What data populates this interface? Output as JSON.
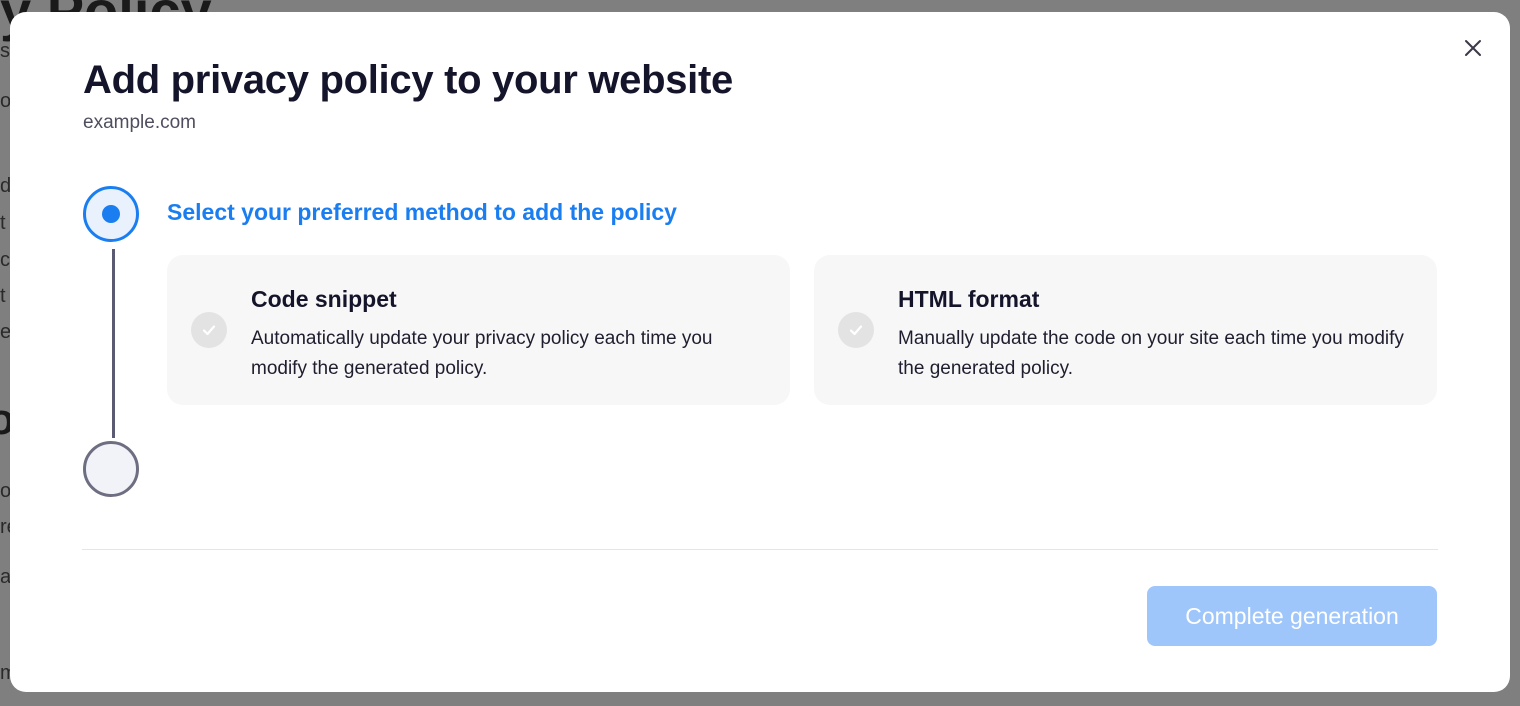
{
  "background": {
    "fragments": [
      "y Policy",
      "s,",
      "or",
      "do",
      "t",
      "ca",
      "t",
      "e",
      "o",
      "or",
      "re",
      "at",
      "m"
    ]
  },
  "modal": {
    "title": "Add privacy policy to your website",
    "subtitle": "example.com",
    "close_icon": "close-icon",
    "stepper": {
      "current_step": 1,
      "total_steps": 2,
      "step_1_heading": "Select your preferred method to add the policy"
    },
    "options": [
      {
        "title": "Code snippet",
        "description": "Automatically update your privacy policy each time you modify the generated policy.",
        "icon": "check-icon",
        "selected": false
      },
      {
        "title": "HTML format",
        "description": "Manually update the code on your site each time you modify the generated policy.",
        "icon": "check-icon",
        "selected": false
      }
    ],
    "complete_button_label": "Complete generation",
    "complete_button_enabled": false
  },
  "colors": {
    "accent": "#1a7ef0",
    "disabled_button": "#9fc6fb",
    "title_text": "#14142b",
    "card_bg": "#f7f7f7"
  }
}
